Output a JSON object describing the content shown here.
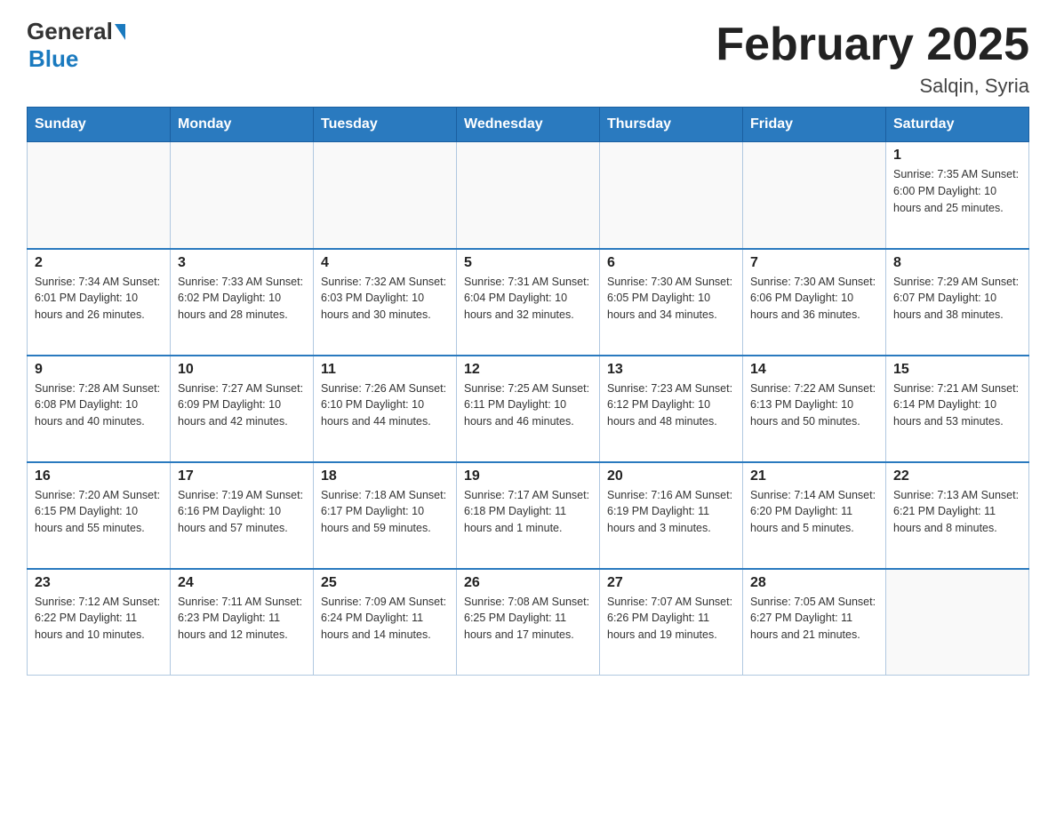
{
  "header": {
    "logo_general": "General",
    "logo_blue": "Blue",
    "title": "February 2025",
    "location": "Salqin, Syria"
  },
  "days_of_week": [
    "Sunday",
    "Monday",
    "Tuesday",
    "Wednesday",
    "Thursday",
    "Friday",
    "Saturday"
  ],
  "weeks": [
    [
      {
        "day": "",
        "info": ""
      },
      {
        "day": "",
        "info": ""
      },
      {
        "day": "",
        "info": ""
      },
      {
        "day": "",
        "info": ""
      },
      {
        "day": "",
        "info": ""
      },
      {
        "day": "",
        "info": ""
      },
      {
        "day": "1",
        "info": "Sunrise: 7:35 AM\nSunset: 6:00 PM\nDaylight: 10 hours\nand 25 minutes."
      }
    ],
    [
      {
        "day": "2",
        "info": "Sunrise: 7:34 AM\nSunset: 6:01 PM\nDaylight: 10 hours\nand 26 minutes."
      },
      {
        "day": "3",
        "info": "Sunrise: 7:33 AM\nSunset: 6:02 PM\nDaylight: 10 hours\nand 28 minutes."
      },
      {
        "day": "4",
        "info": "Sunrise: 7:32 AM\nSunset: 6:03 PM\nDaylight: 10 hours\nand 30 minutes."
      },
      {
        "day": "5",
        "info": "Sunrise: 7:31 AM\nSunset: 6:04 PM\nDaylight: 10 hours\nand 32 minutes."
      },
      {
        "day": "6",
        "info": "Sunrise: 7:30 AM\nSunset: 6:05 PM\nDaylight: 10 hours\nand 34 minutes."
      },
      {
        "day": "7",
        "info": "Sunrise: 7:30 AM\nSunset: 6:06 PM\nDaylight: 10 hours\nand 36 minutes."
      },
      {
        "day": "8",
        "info": "Sunrise: 7:29 AM\nSunset: 6:07 PM\nDaylight: 10 hours\nand 38 minutes."
      }
    ],
    [
      {
        "day": "9",
        "info": "Sunrise: 7:28 AM\nSunset: 6:08 PM\nDaylight: 10 hours\nand 40 minutes."
      },
      {
        "day": "10",
        "info": "Sunrise: 7:27 AM\nSunset: 6:09 PM\nDaylight: 10 hours\nand 42 minutes."
      },
      {
        "day": "11",
        "info": "Sunrise: 7:26 AM\nSunset: 6:10 PM\nDaylight: 10 hours\nand 44 minutes."
      },
      {
        "day": "12",
        "info": "Sunrise: 7:25 AM\nSunset: 6:11 PM\nDaylight: 10 hours\nand 46 minutes."
      },
      {
        "day": "13",
        "info": "Sunrise: 7:23 AM\nSunset: 6:12 PM\nDaylight: 10 hours\nand 48 minutes."
      },
      {
        "day": "14",
        "info": "Sunrise: 7:22 AM\nSunset: 6:13 PM\nDaylight: 10 hours\nand 50 minutes."
      },
      {
        "day": "15",
        "info": "Sunrise: 7:21 AM\nSunset: 6:14 PM\nDaylight: 10 hours\nand 53 minutes."
      }
    ],
    [
      {
        "day": "16",
        "info": "Sunrise: 7:20 AM\nSunset: 6:15 PM\nDaylight: 10 hours\nand 55 minutes."
      },
      {
        "day": "17",
        "info": "Sunrise: 7:19 AM\nSunset: 6:16 PM\nDaylight: 10 hours\nand 57 minutes."
      },
      {
        "day": "18",
        "info": "Sunrise: 7:18 AM\nSunset: 6:17 PM\nDaylight: 10 hours\nand 59 minutes."
      },
      {
        "day": "19",
        "info": "Sunrise: 7:17 AM\nSunset: 6:18 PM\nDaylight: 11 hours\nand 1 minute."
      },
      {
        "day": "20",
        "info": "Sunrise: 7:16 AM\nSunset: 6:19 PM\nDaylight: 11 hours\nand 3 minutes."
      },
      {
        "day": "21",
        "info": "Sunrise: 7:14 AM\nSunset: 6:20 PM\nDaylight: 11 hours\nand 5 minutes."
      },
      {
        "day": "22",
        "info": "Sunrise: 7:13 AM\nSunset: 6:21 PM\nDaylight: 11 hours\nand 8 minutes."
      }
    ],
    [
      {
        "day": "23",
        "info": "Sunrise: 7:12 AM\nSunset: 6:22 PM\nDaylight: 11 hours\nand 10 minutes."
      },
      {
        "day": "24",
        "info": "Sunrise: 7:11 AM\nSunset: 6:23 PM\nDaylight: 11 hours\nand 12 minutes."
      },
      {
        "day": "25",
        "info": "Sunrise: 7:09 AM\nSunset: 6:24 PM\nDaylight: 11 hours\nand 14 minutes."
      },
      {
        "day": "26",
        "info": "Sunrise: 7:08 AM\nSunset: 6:25 PM\nDaylight: 11 hours\nand 17 minutes."
      },
      {
        "day": "27",
        "info": "Sunrise: 7:07 AM\nSunset: 6:26 PM\nDaylight: 11 hours\nand 19 minutes."
      },
      {
        "day": "28",
        "info": "Sunrise: 7:05 AM\nSunset: 6:27 PM\nDaylight: 11 hours\nand 21 minutes."
      },
      {
        "day": "",
        "info": ""
      }
    ]
  ]
}
